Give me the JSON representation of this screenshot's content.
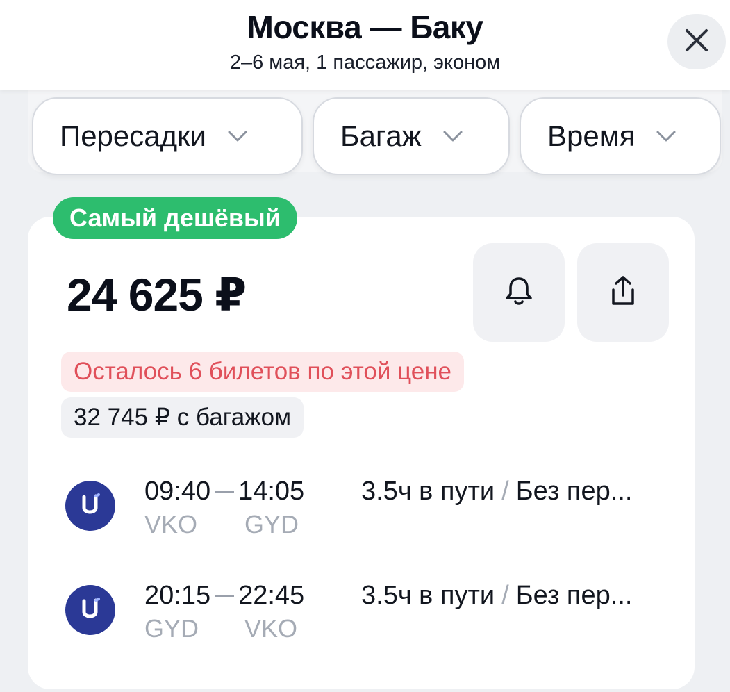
{
  "header": {
    "title": "Москва — Баку",
    "subtitle": "2–6 мая, 1 пассажир, эконом"
  },
  "filters": [
    {
      "label": "Пересадки"
    },
    {
      "label": "Багаж"
    },
    {
      "label": "Время"
    }
  ],
  "offer": {
    "badge": "Самый дешёвый",
    "price": "24 625 ₽",
    "seats_left": "Осталось 6 билетов по этой цене",
    "baggage_price": "32 745 ₽ с багажом"
  },
  "flights": [
    {
      "depart_time": "09:40",
      "arrive_time": "14:05",
      "depart_code": "VKO",
      "arrive_code": "GYD",
      "duration": "3.5ч в пути",
      "stops": "Без пер..."
    },
    {
      "depart_time": "20:15",
      "arrive_time": "22:45",
      "depart_code": "GYD",
      "arrive_code": "VKO",
      "duration": "3.5ч в пути",
      "stops": "Без пер..."
    }
  ],
  "colors": {
    "badge_green": "#2dbd6e",
    "warning_text": "#e0505a",
    "warning_bg": "#fde9ea",
    "airline_logo": "#2b3996"
  },
  "icons": [
    "close-icon",
    "chevron-down-icon",
    "bell-icon",
    "share-icon",
    "airline-logo-icon"
  ]
}
